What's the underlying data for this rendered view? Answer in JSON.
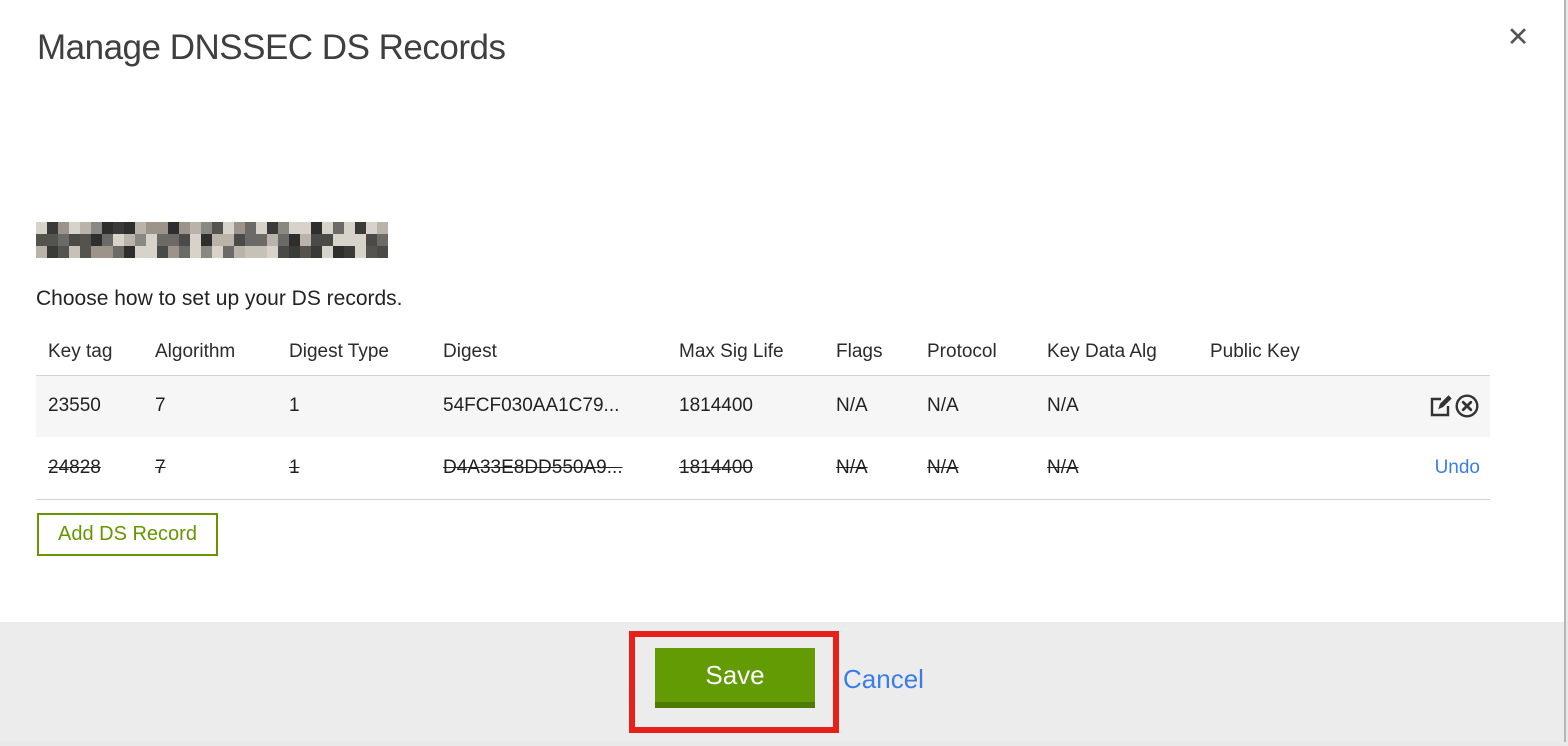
{
  "window": {
    "title": "Manage DNSSEC DS Records",
    "close_icon": "✕"
  },
  "intro": {
    "instruction": "Choose how to set up your DS records."
  },
  "redacted_domain": {
    "note": "pixelated-redacted-domain-name",
    "cols": 32,
    "rows": 3,
    "palette": [
      "#2e2e2e",
      "#4a4a48",
      "#6b6a66",
      "#8a8882",
      "#b9b3a9",
      "#d8d3ca",
      "#55534e",
      "#3a3a38",
      "#9c948a",
      "#c7c2b8"
    ]
  },
  "table": {
    "columns": [
      "Key tag",
      "Algorithm",
      "Digest Type",
      "Digest",
      "Max Sig Life",
      "Flags",
      "Protocol",
      "Key Data Alg",
      "Public Key"
    ],
    "rows": [
      {
        "key_tag": "23550",
        "algorithm": "7",
        "digest_type": "1",
        "digest": "54FCF030AA1C79...",
        "max_sig_life": "1814400",
        "flags": "N/A",
        "protocol": "N/A",
        "key_data_alg": "N/A",
        "public_key": "",
        "state": "current"
      },
      {
        "key_tag": "24828",
        "algorithm": "7",
        "digest_type": "1",
        "digest": "D4A33E8DD550A9...",
        "max_sig_life": "1814400",
        "flags": "N/A",
        "protocol": "N/A",
        "key_data_alg": "N/A",
        "public_key": "",
        "state": "deleted",
        "undo_label": "Undo"
      }
    ]
  },
  "buttons": {
    "add_ds_record": "Add DS Record",
    "save": "Save",
    "cancel": "Cancel"
  },
  "icons": {
    "edit": "edit-icon",
    "delete": "delete-icon"
  },
  "colors": {
    "accent_green": "#629b04",
    "accent_green_dark": "#4d7a02",
    "outline_green": "#679500",
    "link_blue": "#3b7de8",
    "annotation_red": "#e8201a",
    "footer_gray": "#ececec",
    "row_gray": "#f6f6f6"
  }
}
